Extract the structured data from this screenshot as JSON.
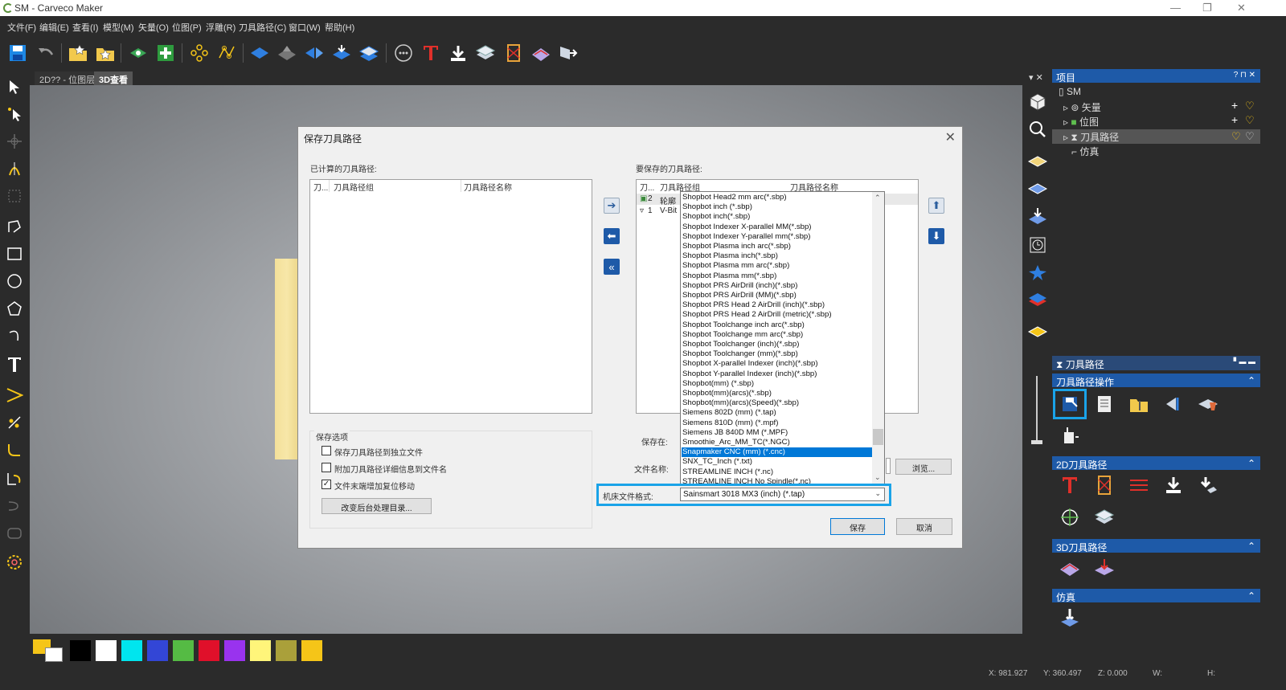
{
  "window": {
    "title": "SM - Carveco Maker",
    "minimize": "—",
    "restore": "❐",
    "close": "✕"
  },
  "menu": [
    "文件(F)",
    "编辑(E)",
    "查看(I)",
    "模型(M)",
    "矢量(O)",
    "位图(P)",
    "浮雕(R)",
    "刀具路径(C)",
    "窗口(W)",
    "帮助(H)"
  ],
  "tabs": [
    "2D?? - 位图层",
    "3D查看"
  ],
  "palette": {
    "colors": [
      "#000000",
      "#ffffff",
      "#00e5ee",
      "#3346d6",
      "#55bb44",
      "#e0102a",
      "#9933ee",
      "#fff57a",
      "#aaa03a",
      "#f5c518"
    ]
  },
  "status": {
    "x": "X: 981.927",
    "y": "Y: 360.497",
    "z": "Z: 0.000",
    "w": "W:",
    "h": "H:"
  },
  "project": {
    "header": "项目",
    "header_ctrl": "? ⊓ ✕",
    "root": "SM",
    "items": [
      "矢量",
      "位图",
      "刀具路径",
      "仿真"
    ]
  },
  "toolpath_panel": {
    "header": "刀具路径",
    "sections": [
      "刀具路径操作",
      "2D刀具路径",
      "3D刀具路径",
      "仿真"
    ]
  },
  "dialog": {
    "title": "保存刀具路径",
    "close": "✕",
    "computed_label": "已计算的刀具路径:",
    "save_label": "要保存的刀具路径:",
    "left_cols": [
      "刀...",
      "刀具路径组",
      "刀具路径名称"
    ],
    "right_cols": [
      "刀...",
      "刀具路径组",
      "刀具路径名称"
    ],
    "right_rows": [
      [
        "2",
        "轮廓"
      ],
      [
        "1",
        "V-Bit"
      ]
    ],
    "options_title": "保存选项",
    "options": [
      {
        "label": "保存刀具路径到独立文件",
        "checked": false
      },
      {
        "label": "附加刀具路径详细信息到文件名",
        "checked": false
      },
      {
        "label": "文件末端增加复位移动",
        "checked": true
      }
    ],
    "change_dir_button": "改变后台处理目录...",
    "save_in_label": "保存在:",
    "filename_label": "文件名称:",
    "browse_button": "浏览...",
    "format_label": "机床文件格式:",
    "format_value": "Sainsmart 3018 MX3 (inch) (*.tap)",
    "save_button": "保存",
    "cancel_button": "取消",
    "format_options": [
      "Shopbot Head2 mm arc(*.sbp)",
      "Shopbot inch (*.sbp)",
      "Shopbot inch(*.sbp)",
      "Shopbot Indexer X-parallel MM(*.sbp)",
      "Shopbot Indexer Y-parallel mm(*.sbp)",
      "Shopbot Plasma inch arc(*.sbp)",
      "Shopbot Plasma inch(*.sbp)",
      "Shopbot Plasma mm arc(*.sbp)",
      "Shopbot Plasma mm(*.sbp)",
      "Shopbot PRS AirDrill (inch)(*.sbp)",
      "Shopbot PRS AirDrill (MM)(*.sbp)",
      "Shopbot PRS Head 2 AirDrill (inch)(*.sbp)",
      "Shopbot PRS Head 2 AirDrill (metric)(*.sbp)",
      "Shopbot Toolchange inch arc(*.sbp)",
      "Shopbot Toolchange mm arc(*.sbp)",
      "Shopbot Toolchanger (inch)(*.sbp)",
      "Shopbot Toolchanger (mm)(*.sbp)",
      "Shopbot X-parallel Indexer (inch)(*.sbp)",
      "Shopbot Y-parallel Indexer (inch)(*.sbp)",
      "Shopbot(mm) (*.sbp)",
      "Shopbot(mm)(arcs)(*.sbp)",
      "Shopbot(mm)(arcs)(Speed)(*.sbp)",
      "Siemens 802D (mm) (*.tap)",
      "Siemens 810D (mm) (*.mpf)",
      "Siemens JB 840D MM (*.MPF)",
      "Smoothie_Arc_MM_TC(*.NGC)",
      "Snapmaker CNC (mm) (*.cnc)",
      "SNX_TC_Inch (*.txt)",
      "STREAMLINE INCH (*.nc)",
      "STREAMLINE INCH No Spindle(*.nc)"
    ],
    "selected_option": "Snapmaker CNC (mm) (*.cnc)"
  }
}
